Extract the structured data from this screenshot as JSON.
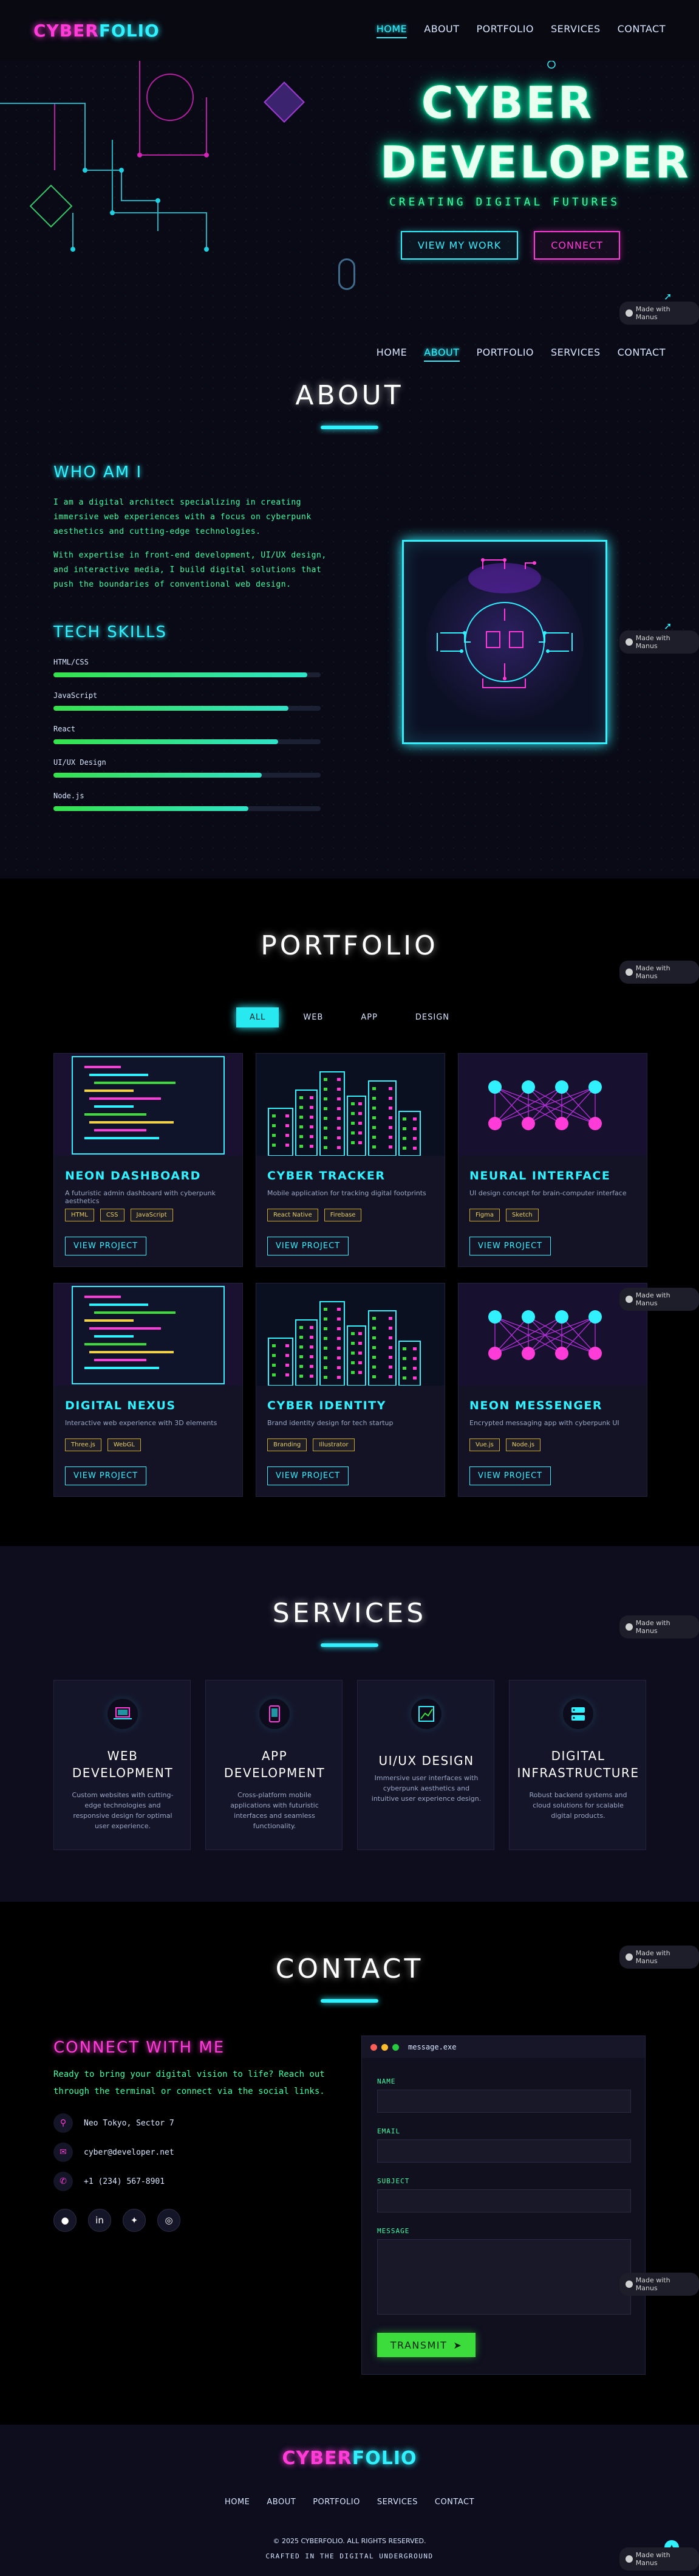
{
  "brand": {
    "part1": "CYBER",
    "part2": "FOLIO",
    "colors": {
      "magenta": "#ff3cd8",
      "cyan": "#31f1ff",
      "green": "#3dffa5"
    }
  },
  "nav": [
    {
      "label": "HOME"
    },
    {
      "label": "ABOUT"
    },
    {
      "label": "PORTFOLIO"
    },
    {
      "label": "SERVICES"
    },
    {
      "label": "CONTACT"
    }
  ],
  "hero": {
    "title_line1": "CYBER",
    "title_line2": "DEVELOPER",
    "subtitle": "CREATING DIGITAL FUTURES",
    "btn_work": "VIEW MY WORK",
    "btn_connect": "CONNECT"
  },
  "badge": {
    "label": "Made with Manus"
  },
  "about": {
    "title": "ABOUT",
    "who_heading": "WHO AM I",
    "para1": "I am a digital architect specializing in creating immersive web experiences with a focus on cyberpunk aesthetics and cutting-edge technologies.",
    "para2": "With expertise in front-end development, UI/UX design, and interactive media, I build digital solutions that push the boundaries of conventional web design.",
    "skills_heading": "TECH SKILLS",
    "skills": [
      {
        "name": "HTML/CSS",
        "level": 0.95
      },
      {
        "name": "JavaScript",
        "level": 0.88
      },
      {
        "name": "React",
        "level": 0.84
      },
      {
        "name": "UI/UX Design",
        "level": 0.78
      },
      {
        "name": "Node.js",
        "level": 0.73
      }
    ]
  },
  "portfolio": {
    "title": "PORTFOLIO",
    "filters": [
      {
        "label": "ALL",
        "active": true
      },
      {
        "label": "WEB"
      },
      {
        "label": "APP"
      },
      {
        "label": "DESIGN"
      }
    ],
    "cards": [
      {
        "title": "NEON DASHBOARD",
        "desc": "A futuristic admin dashboard with cyberpunk aesthetics",
        "tags": [
          "HTML",
          "CSS",
          "JavaScript"
        ],
        "cta": "VIEW PROJECT",
        "thumb": "code"
      },
      {
        "title": "CYBER TRACKER",
        "desc": "Mobile application for tracking digital footprints",
        "tags": [
          "React Native",
          "Firebase"
        ],
        "cta": "VIEW PROJECT",
        "thumb": "city"
      },
      {
        "title": "NEURAL INTERFACE",
        "desc": "UI design concept for brain-computer interface",
        "tags": [
          "Figma",
          "Sketch"
        ],
        "cta": "VIEW PROJECT",
        "thumb": "network"
      },
      {
        "title": "DIGITAL NEXUS",
        "desc": "Interactive web experience with 3D elements",
        "tags": [
          "Three.js",
          "WebGL"
        ],
        "cta": "VIEW PROJECT",
        "thumb": "code"
      },
      {
        "title": "CYBER IDENTITY",
        "desc": "Brand identity design for tech startup",
        "tags": [
          "Branding",
          "Illustrator"
        ],
        "cta": "VIEW PROJECT",
        "thumb": "city"
      },
      {
        "title": "NEON MESSENGER",
        "desc": "Encrypted messaging app with cyberpunk UI",
        "tags": [
          "Vue.js",
          "Node.js"
        ],
        "cta": "VIEW PROJECT",
        "thumb": "network"
      }
    ]
  },
  "services": {
    "title": "SERVICES",
    "items": [
      {
        "line1": "WEB",
        "line2": "DEVELOPMENT",
        "desc": "Custom websites with cutting-edge technologies and responsive design for optimal user experience.",
        "icon": "laptop-icon"
      },
      {
        "line1": "APP",
        "line2": "DEVELOPMENT",
        "desc": "Cross-platform mobile applications with futuristic interfaces and seamless functionality.",
        "icon": "mobile-icon"
      },
      {
        "line1": "UI/UX DESIGN",
        "line2": "",
        "desc": "Immersive user interfaces with cyberpunk aesthetics and intuitive user experience design.",
        "icon": "chart-icon"
      },
      {
        "line1": "DIGITAL",
        "line2": "INFRASTRUCTURE",
        "desc": "Robust backend systems and cloud solutions for scalable digital products.",
        "icon": "server-icon"
      }
    ]
  },
  "contact": {
    "title": "CONTACT",
    "heading": "CONNECT WITH ME",
    "lead": "Ready to bring your digital vision to life? Reach out through the terminal or connect via the social links.",
    "location": "Neo Tokyo, Sector 7",
    "email": "cyber@developer.net",
    "phone": "+1 (234) 567-8901",
    "terminal": {
      "title": "message.exe",
      "name": "NAME",
      "email": "EMAIL",
      "subject": "SUBJECT",
      "message": "MESSAGE",
      "send": "TRANSMIT"
    }
  },
  "footer": {
    "copyright": "© 2025 CYBERFOLIO. ALL RIGHTS RESERVED.",
    "crafted": "CRAFTED IN THE DIGITAL UNDERGROUND"
  }
}
